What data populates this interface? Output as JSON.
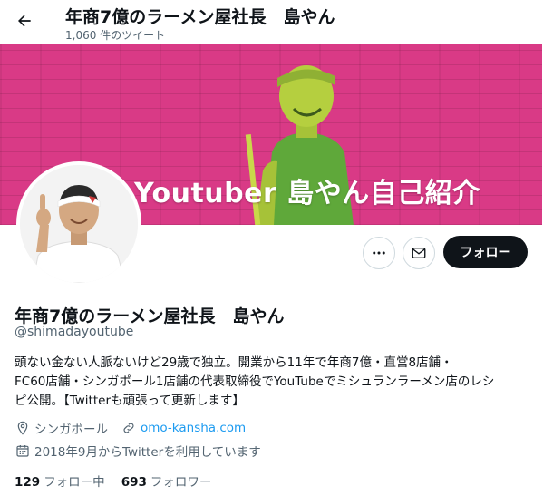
{
  "header": {
    "title": "年商7億のラーメン屋社長　島やん",
    "tweet_count": "1,060 件のツイート"
  },
  "banner": {
    "text": "Youtuber 島やん自己紹介"
  },
  "actions": {
    "follow_label": "フォロー"
  },
  "profile": {
    "name": "年商7億のラーメン屋社長　島やん",
    "handle": "@shimadayoutube",
    "bio": [
      "頭ない金ない人脈ないけど29歳で独立。開業から11年で年商7億・直営8店舗・",
      "FC60店舗・シンガポール1店舗の代表取締役でYouTubeでミシュランラーメン店のレシ",
      "ピ公開。【Twitterも頑張って更新します】"
    ],
    "location": "シンガポール",
    "website": "omo-kansha.com",
    "joined": "2018年9月からTwitterを利用しています"
  },
  "stats": {
    "following_count": "129",
    "following_label": "フォロー中",
    "followers_count": "693",
    "followers_label": "フォロワー"
  },
  "colors": {
    "banner_bg": "#d93a86",
    "link": "#1d9bf0",
    "text_secondary": "#536471",
    "button_dark": "#0f1419"
  }
}
